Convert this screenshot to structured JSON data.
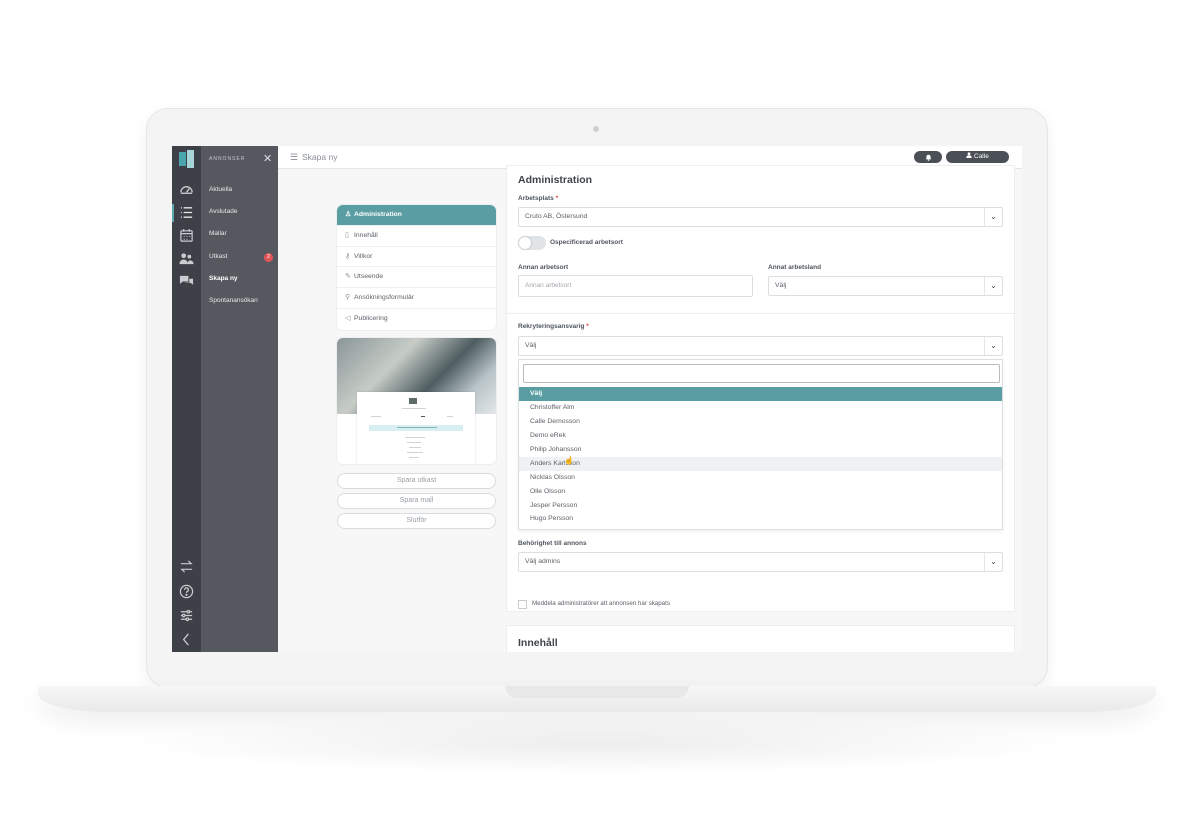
{
  "app": {
    "menu_title": "ANNONSER",
    "breadcrumb": "Skapa ny",
    "user_name": "Calle"
  },
  "menu": {
    "items": [
      {
        "label": "Aktuella"
      },
      {
        "label": "Avslutade"
      },
      {
        "label": "Mallar"
      },
      {
        "label": "Utkast",
        "badge": "2"
      },
      {
        "label": "Skapa ny",
        "active": true
      },
      {
        "label": "Spontanansökan"
      }
    ]
  },
  "steps": [
    {
      "label": "Administration",
      "icon": "user-icon",
      "active": true
    },
    {
      "label": "Innehåll",
      "icon": "document-icon"
    },
    {
      "label": "Villkor",
      "icon": "key-icon"
    },
    {
      "label": "Utseende",
      "icon": "pencil-icon"
    },
    {
      "label": "Ansökningsformulär",
      "icon": "pin-icon"
    },
    {
      "label": "Publicering",
      "icon": "megaphone-icon"
    }
  ],
  "actions": {
    "save_draft": "Spara utkast",
    "save_template": "Spara mall",
    "finish": "Slutför"
  },
  "form": {
    "title": "Administration",
    "workplace_label": "Arbetsplats",
    "workplace_value": "Cruto AB, Östersund",
    "toggle_label": "Ospecificerad arbetsort",
    "other_location_label": "Annan arbetsort",
    "other_location_placeholder": "Annan arbetsort",
    "other_country_label": "Annat arbetsland",
    "other_country_value": "Välj",
    "recruiter_label": "Rekryteringsansvarig",
    "recruiter_value": "Välj",
    "recruiter_options": [
      "Välj",
      "Christoffer Alm",
      "Calle Demosson",
      "Demo eRek",
      "Philip Johansson",
      "Anders Karlsson",
      "Nicklas Olsson",
      "Olle Olsson",
      "Jesper Persson",
      "Hugo Persson"
    ],
    "permission_label": "Behörighet till annons",
    "permission_value": "Välj admins",
    "notify_label": "Meddela administratörer att annonsen har skapats"
  },
  "content_section": {
    "title": "Innehåll"
  },
  "colors": {
    "accent": "#5a9ea4",
    "sidebar_dark": "#3d4147",
    "sidebar": "#55595f",
    "badge": "#e05656"
  }
}
